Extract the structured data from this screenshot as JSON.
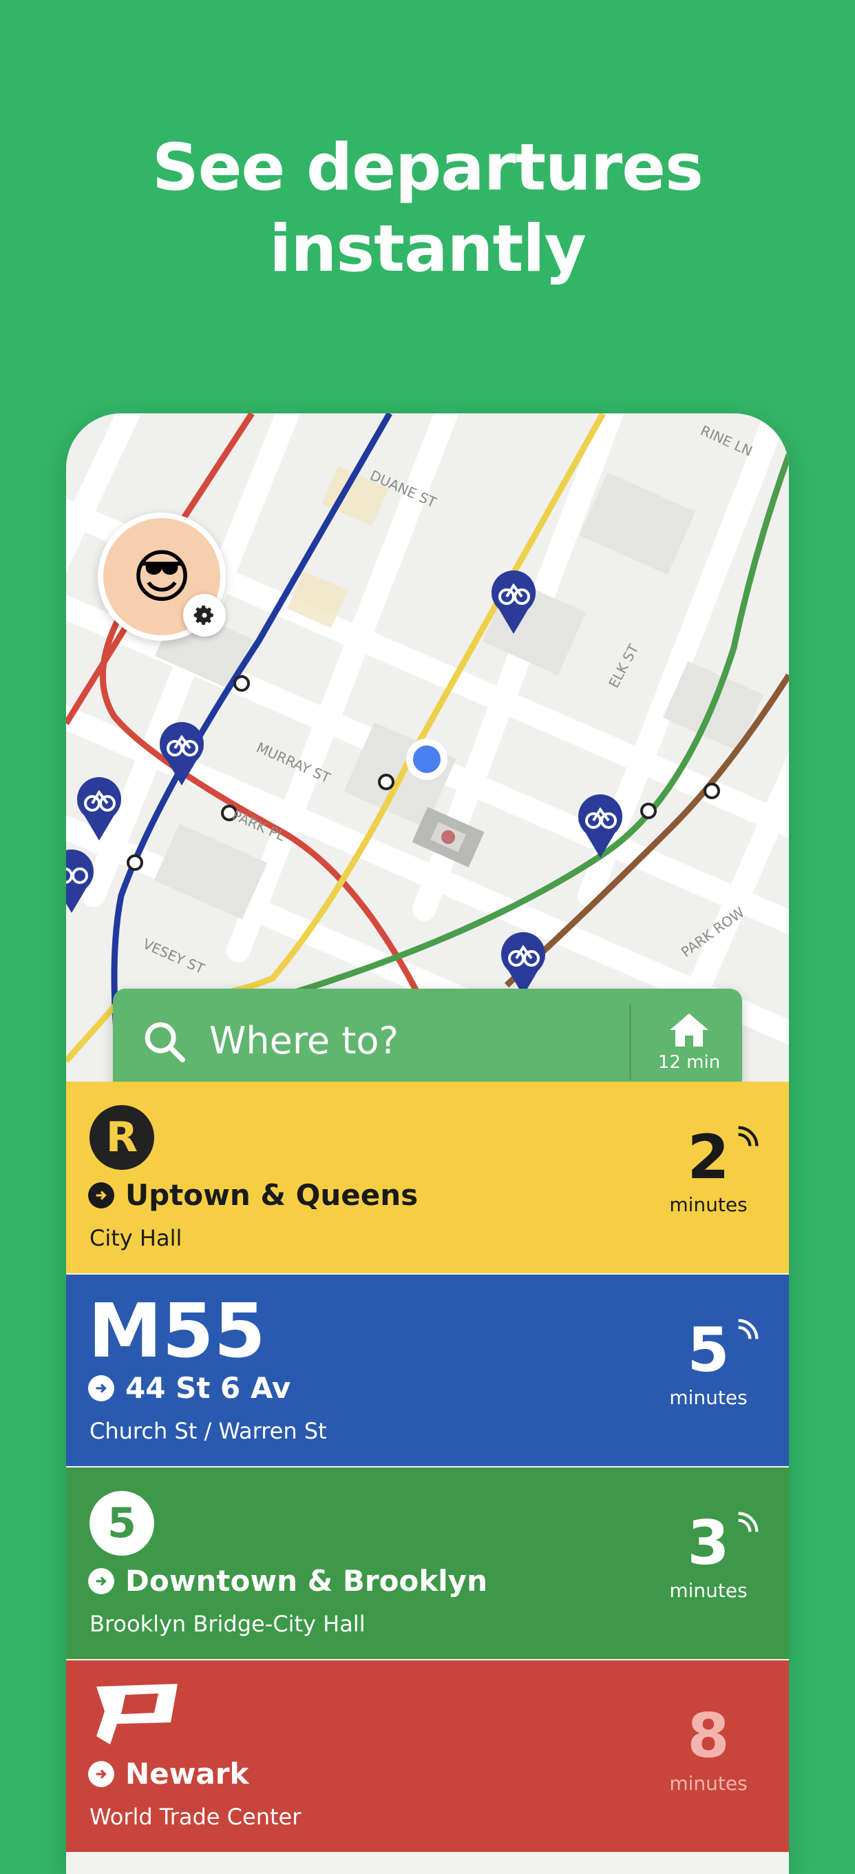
{
  "headline": {
    "line1": "See departures",
    "line2": "instantly"
  },
  "map": {
    "streets": [
      "DUANE ST",
      "MURRAY ST",
      "PARK PL",
      "ELK ST",
      "PARK ROW",
      "VESEY ST",
      "RINE LN"
    ],
    "colors": {
      "red_line": "#d34a3d",
      "blue_line": "#1f3a9c",
      "yellow_line": "#eed14a",
      "green_line": "#4a9d4a",
      "brown_line": "#8a5a36",
      "location": "#4a7ff0"
    }
  },
  "avatar": {
    "emoji": "😎",
    "icon": "gear-icon"
  },
  "search": {
    "placeholder": "Where to?",
    "home_time": "12 min",
    "icon": "search-icon",
    "home_icon": "home-icon"
  },
  "departures": [
    {
      "route": "R",
      "direction": "Uptown & Queens",
      "stop": "City Hall",
      "eta": "2",
      "unit": "minutes",
      "color": "#f5ce44"
    },
    {
      "route": "M55",
      "direction": "44 St 6 Av",
      "stop": "Church St / Warren St",
      "eta": "5",
      "unit": "minutes",
      "color": "#2a5aaf"
    },
    {
      "route": "5",
      "direction": "Downtown & Brooklyn",
      "stop": "Brooklyn Bridge-City Hall",
      "eta": "3",
      "unit": "minutes",
      "color": "#3d9848"
    },
    {
      "route": "PATH",
      "direction": "Newark",
      "stop": "World Trade Center",
      "eta": "8",
      "unit": "minutes",
      "color": "#c8453b"
    }
  ]
}
